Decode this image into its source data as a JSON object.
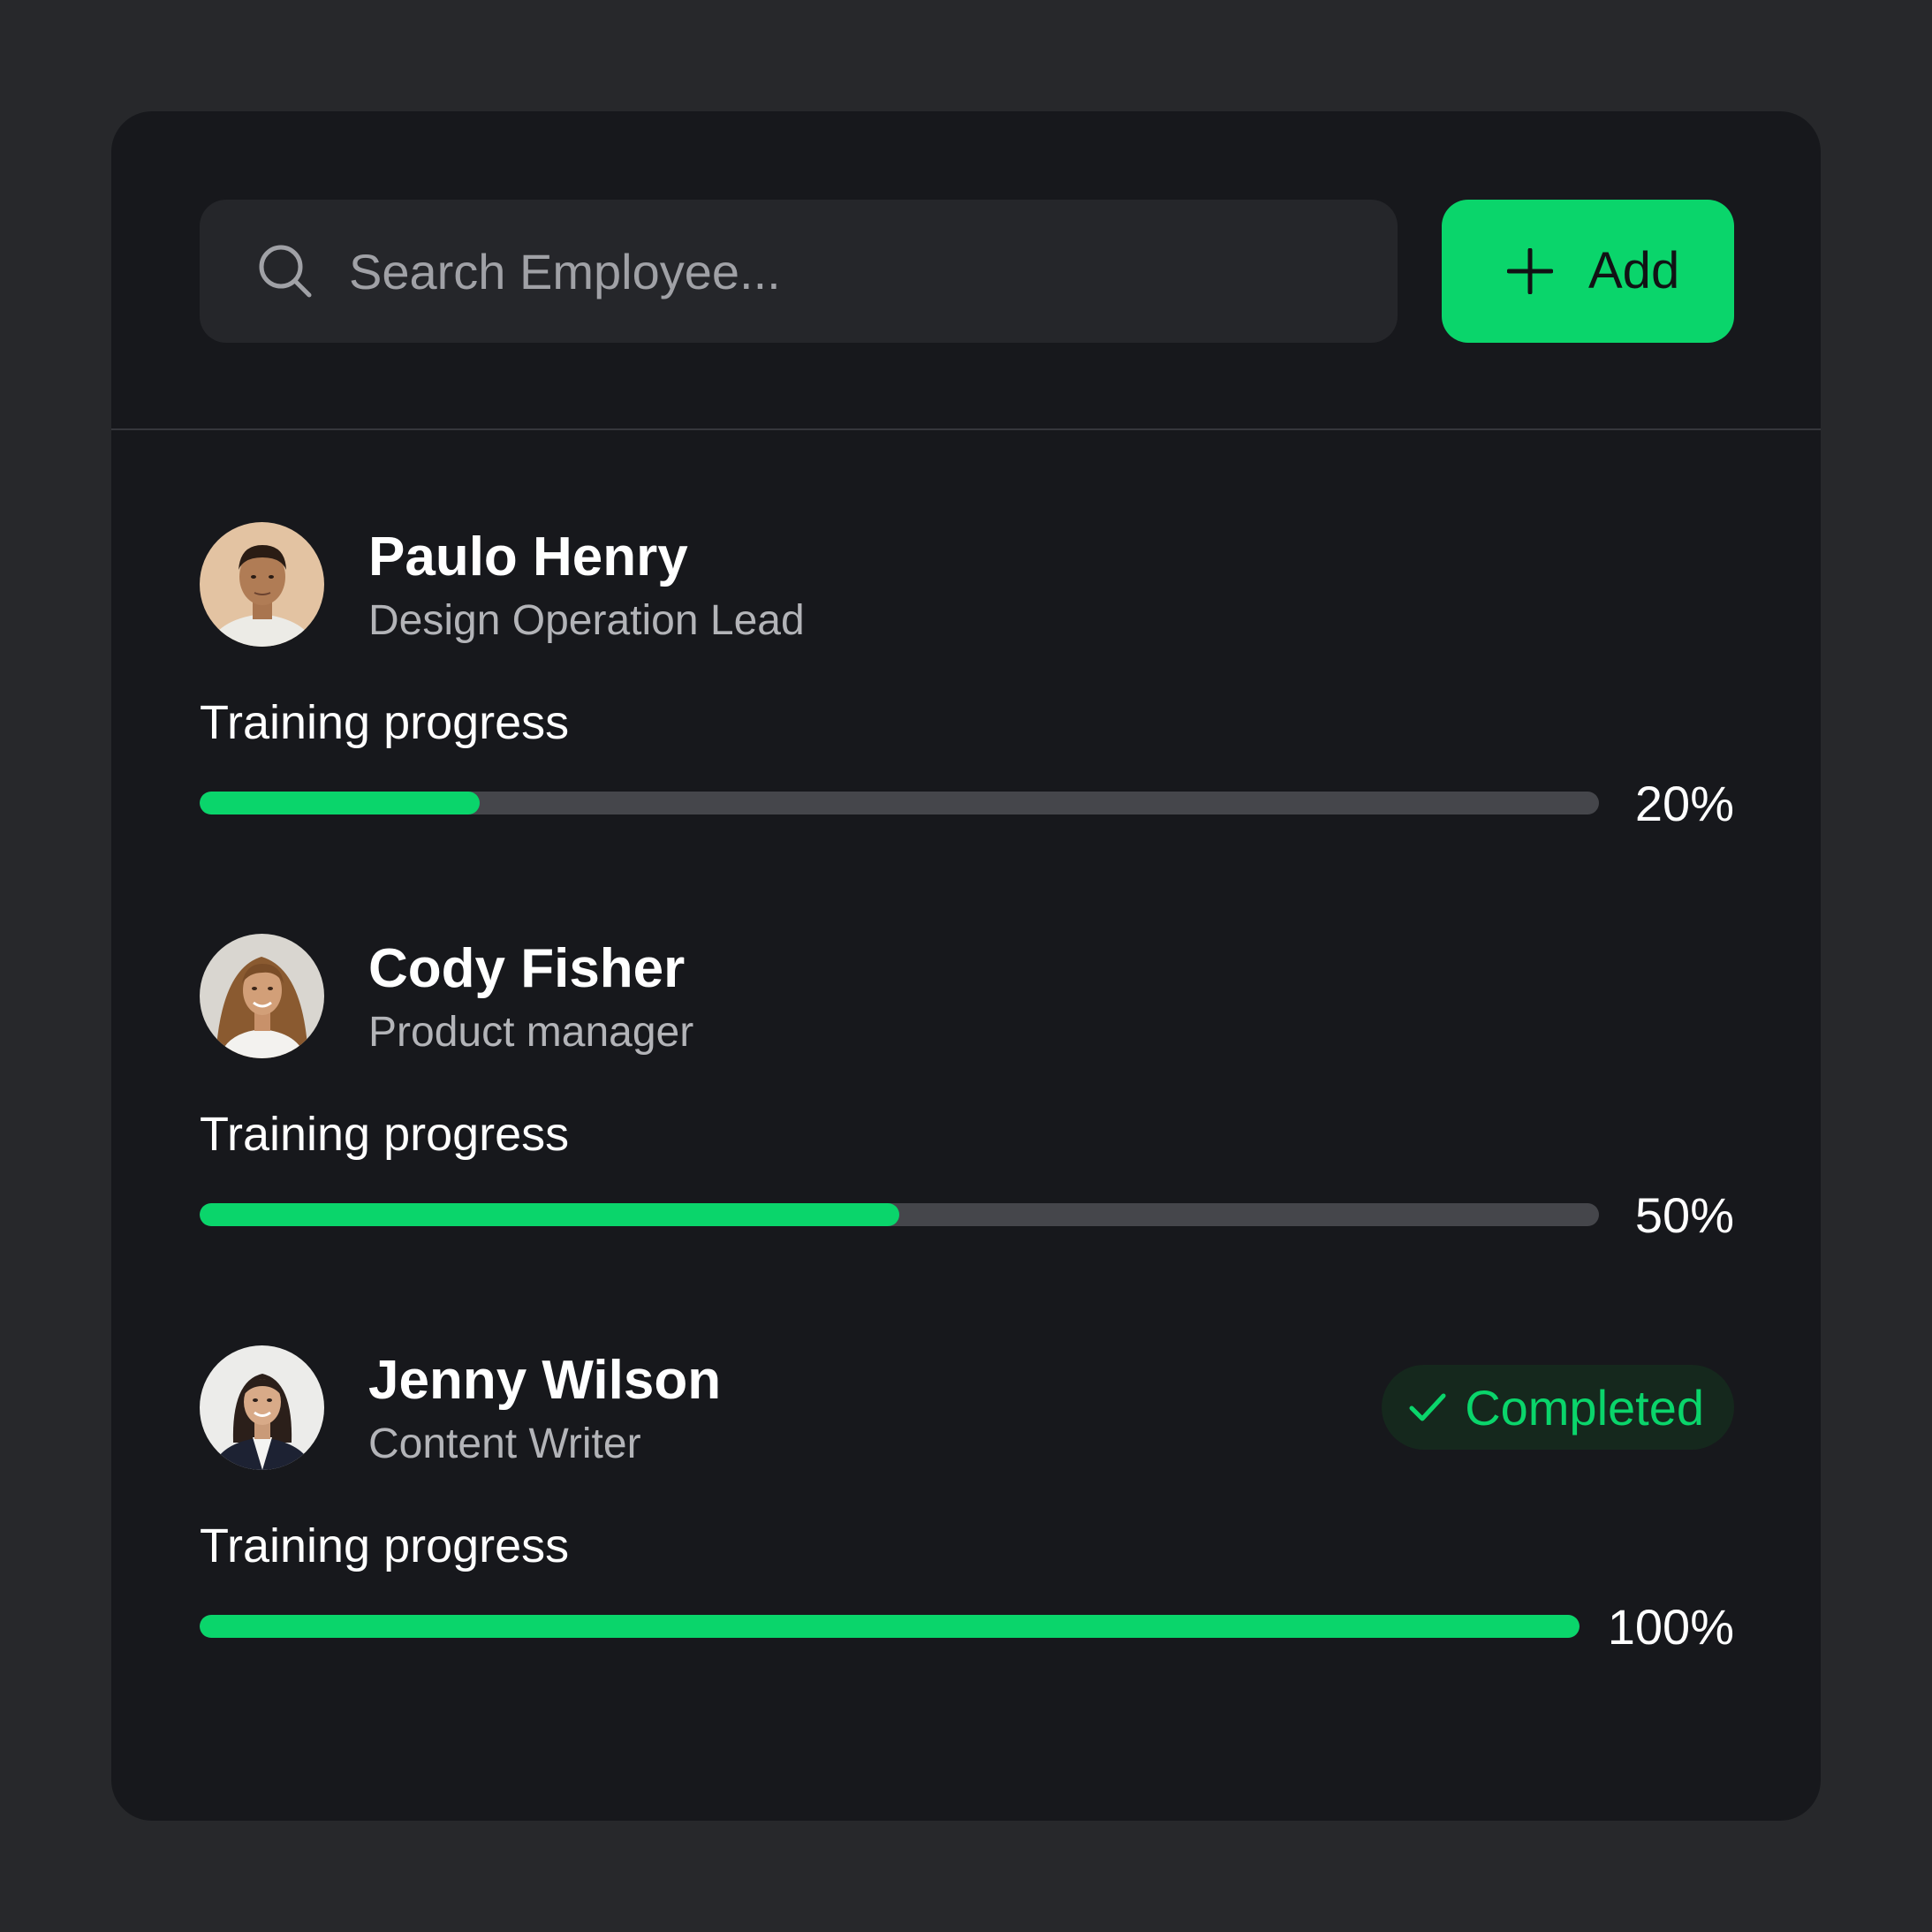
{
  "search": {
    "placeholder": "Search Employee...",
    "icon": "search-icon"
  },
  "toolbar": {
    "add_label": "Add",
    "add_icon": "plus-icon"
  },
  "colors": {
    "accent": "#0ad56b",
    "background": "#27282b",
    "card": "#17181c",
    "track": "#45464b",
    "badge_bg": "#15281d"
  },
  "employees": [
    {
      "name": "Paulo Henry",
      "role": "Design Operation Lead",
      "progress_label": "Training progress",
      "progress_value": 0.2,
      "progress_text": "20%",
      "status": ""
    },
    {
      "name": "Cody Fisher",
      "role": "Product manager",
      "progress_label": "Training progress",
      "progress_value": 0.5,
      "progress_text": "50%",
      "status": ""
    },
    {
      "name": "Jenny Wilson",
      "role": "Content Writer",
      "progress_label": "Training progress",
      "progress_value": 1.0,
      "progress_text": "100%",
      "status": "Completed",
      "status_icon": "check-icon"
    }
  ]
}
